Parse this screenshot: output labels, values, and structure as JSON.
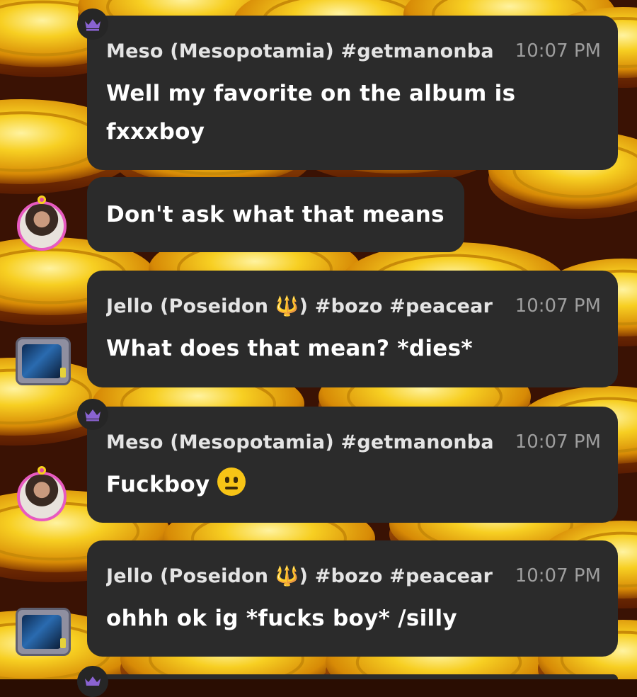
{
  "messages": [
    {
      "author": "Meso (Mesopotamia) #getmanonba",
      "time": "10:07 PM",
      "lines": [
        "Well my favorite on the album is",
        "fxxxboy"
      ],
      "continuation": "Don't ask what that means",
      "badge": "crown-icon",
      "avatar": "avatar-girl"
    },
    {
      "author_prefix": "Jello (Poseidon ",
      "author_icon": "🔱",
      "author_suffix": ") #bozo #peacear",
      "time": "10:07 PM",
      "text": "What does that mean? *dies*",
      "avatar": "avatar-tv"
    },
    {
      "author": "Meso (Mesopotamia) #getmanonba",
      "time": "10:07 PM",
      "text": "Fuckboy",
      "emoji": "neutral-face-icon",
      "badge": "crown-icon",
      "avatar": "avatar-girl"
    },
    {
      "author_prefix": "Jello (Poseidon ",
      "author_icon": "🔱",
      "author_suffix": ") #bozo #peacear",
      "time": "10:07 PM",
      "text": "ohhh ok ig *fucks boy* /silly",
      "avatar": "avatar-tv"
    }
  ],
  "colors": {
    "bubble": "#2b2b2b",
    "crown": "#8a63d2",
    "avatar_ring": "#e75ac0",
    "coin_gold": "#f3c21a"
  }
}
